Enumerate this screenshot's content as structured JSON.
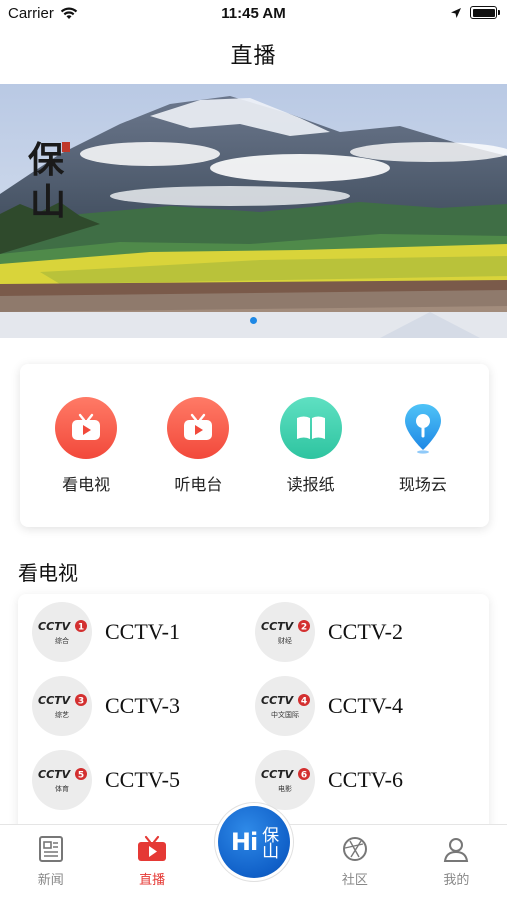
{
  "status_bar": {
    "carrier": "Carrier",
    "time": "11:45 AM"
  },
  "nav": {
    "title": "直播"
  },
  "banner": {
    "calligraphy": "保山",
    "active_slide": 1
  },
  "quick_entries": [
    {
      "label": "看电视",
      "icon": "tv-icon",
      "color": "#f2493b"
    },
    {
      "label": "听电台",
      "icon": "radio-tv-icon",
      "color": "#f2493b"
    },
    {
      "label": "读报纸",
      "icon": "book-icon",
      "color": "#2ec4a0"
    },
    {
      "label": "现场云",
      "icon": "location-pin-icon",
      "color": "#1e88e5"
    }
  ],
  "section": {
    "title": "看电视"
  },
  "channels": [
    {
      "name": "CCTV-1",
      "logo_text": "CCTV",
      "number": "1",
      "sub": "综合"
    },
    {
      "name": "CCTV-2",
      "logo_text": "CCTV",
      "number": "2",
      "sub": "财经"
    },
    {
      "name": "CCTV-3",
      "logo_text": "CCTV",
      "number": "3",
      "sub": "综艺"
    },
    {
      "name": "CCTV-4",
      "logo_text": "CCTV",
      "number": "4",
      "sub": "中文国际"
    },
    {
      "name": "CCTV-5",
      "logo_text": "CCTV",
      "number": "5",
      "sub": "体育"
    },
    {
      "name": "CCTV-6",
      "logo_text": "CCTV",
      "number": "6",
      "sub": "电影"
    }
  ],
  "tab_bar": {
    "tabs": [
      {
        "label": "新闻",
        "icon": "news-icon",
        "active": false
      },
      {
        "label": "直播",
        "icon": "live-tv-icon",
        "active": true
      },
      {
        "label": "社区",
        "icon": "community-icon",
        "active": false
      },
      {
        "label": "我的",
        "icon": "profile-icon",
        "active": false
      }
    ],
    "center_button": {
      "text": "Hi",
      "calligraphy": "保山"
    }
  },
  "colors": {
    "accent_red": "#e53935",
    "accent_blue": "#1e88e5"
  }
}
